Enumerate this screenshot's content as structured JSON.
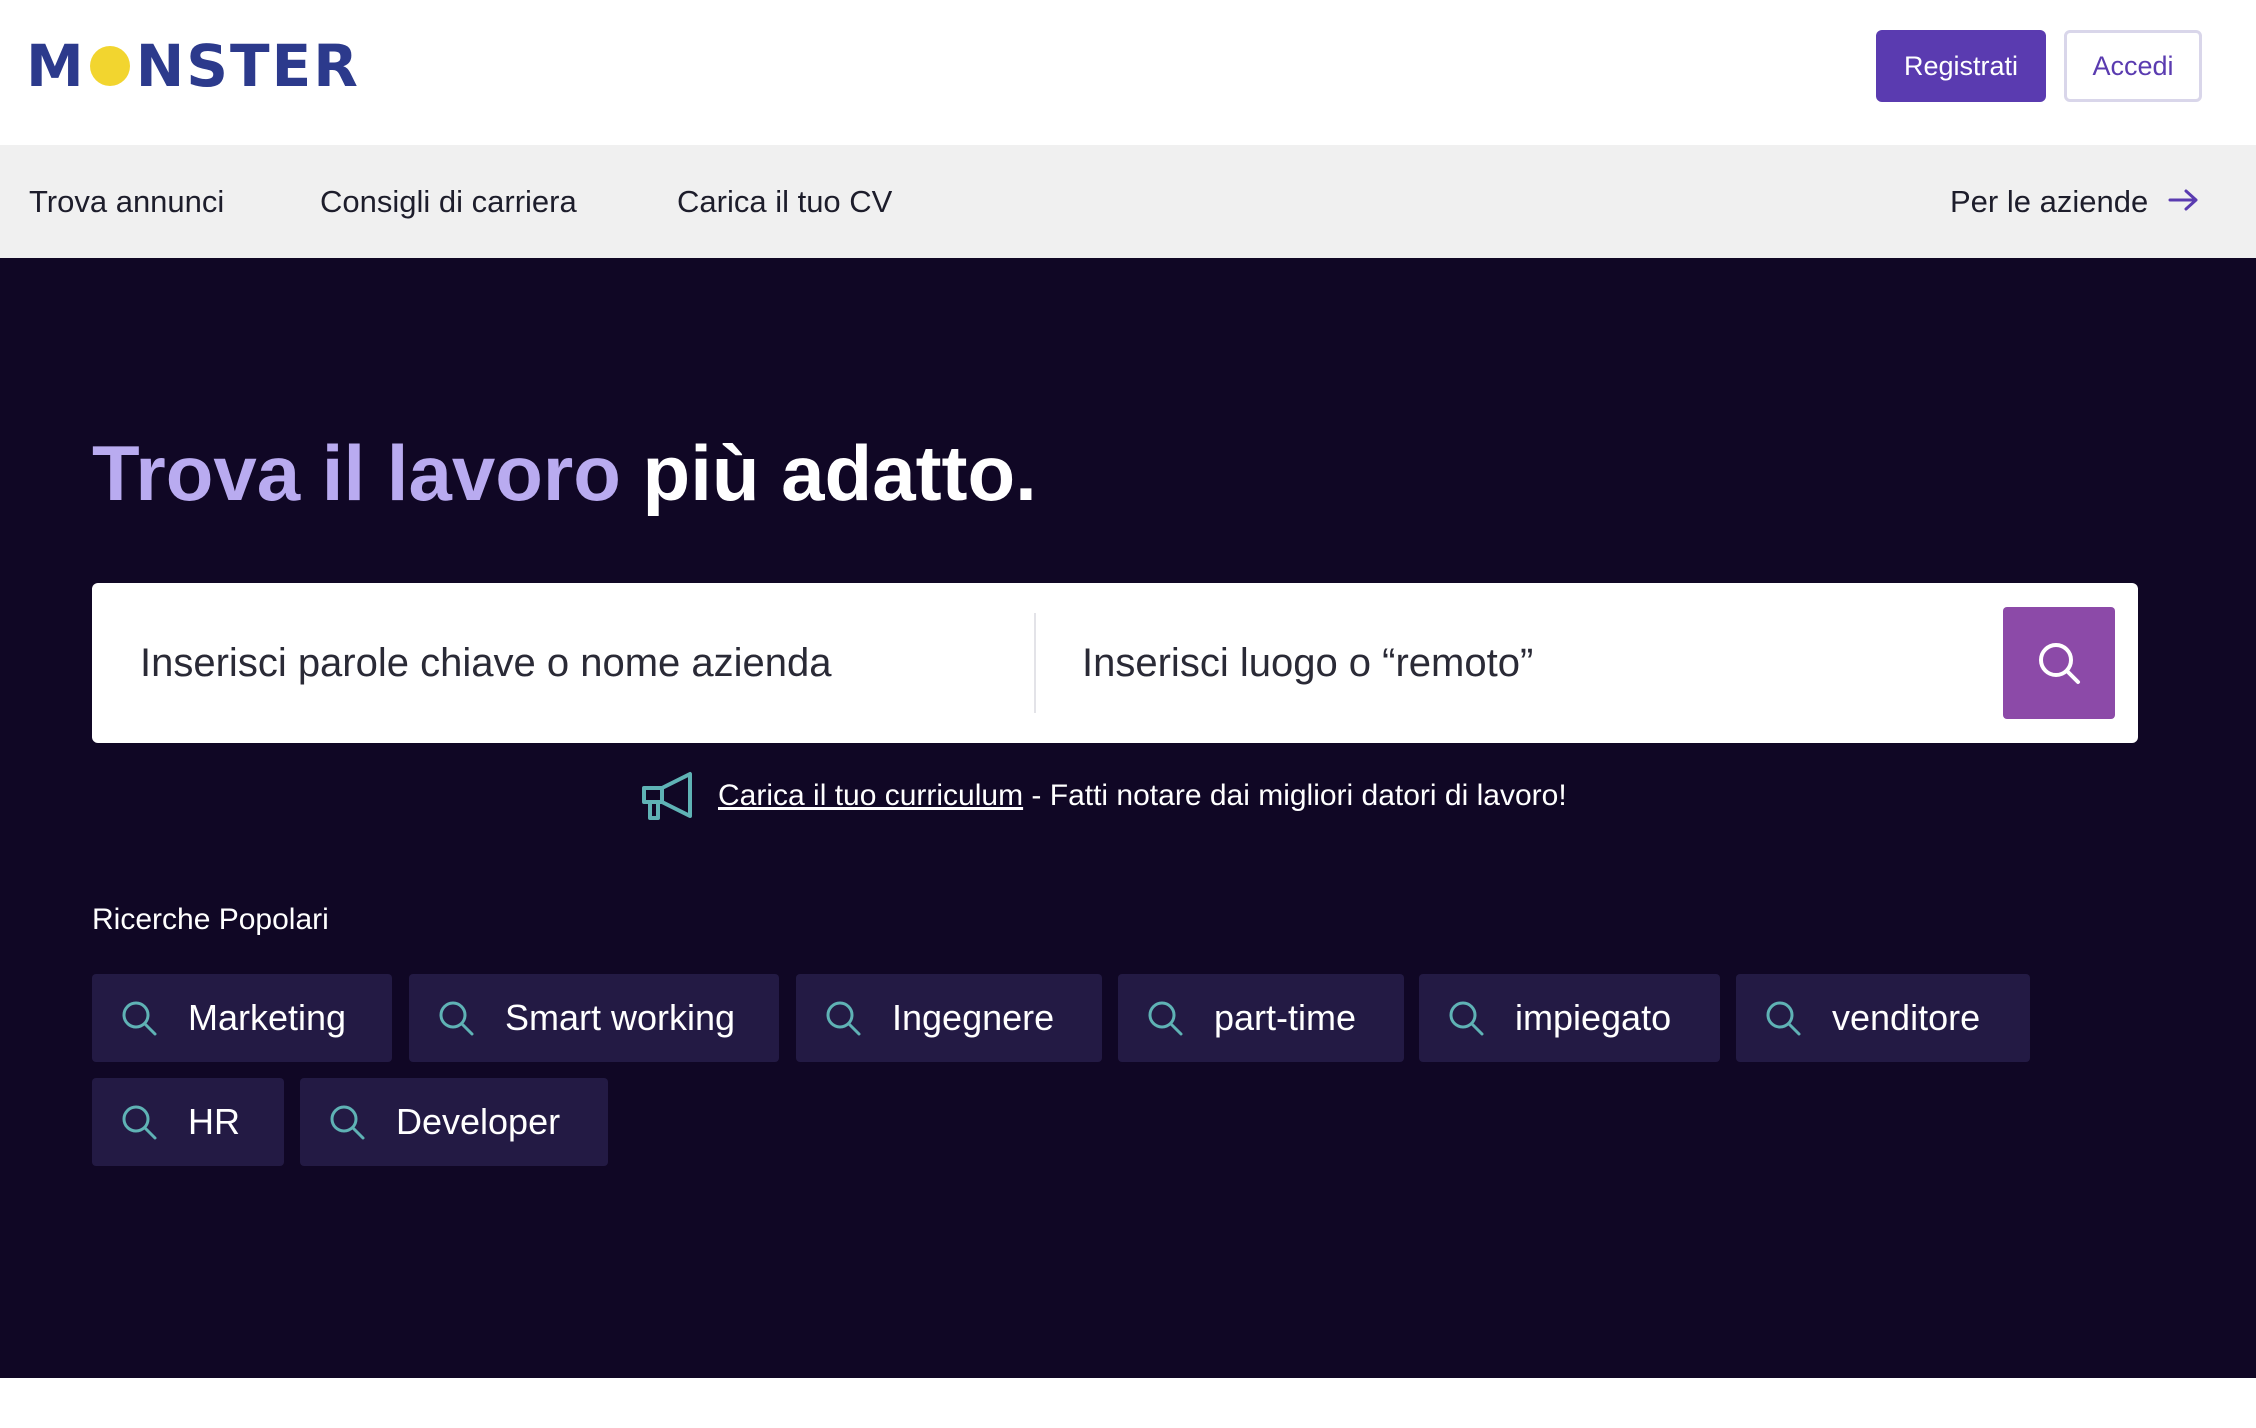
{
  "header": {
    "logo_text": "MONSTER",
    "logo_prefix": "M",
    "logo_suffix": "NSTER",
    "register_label": "Registrati",
    "login_label": "Accedi",
    "colors": {
      "brand": "#2c3a8c",
      "logo_dot": "#f2d52f",
      "accent": "#5a3bb0"
    }
  },
  "nav": {
    "items": [
      {
        "label": "Trova annunci"
      },
      {
        "label": "Consigli di carriera"
      },
      {
        "label": "Carica il tuo CV"
      }
    ],
    "business_label": "Per le aziende",
    "business_icon": "arrow-right-icon"
  },
  "hero": {
    "headline_part1": "Trova il lavoro",
    "headline_part2": "più adatto.",
    "search": {
      "keyword_placeholder": "Inserisci parole chiave o nome azienda",
      "location_placeholder": "Inserisci luogo o “remoto”",
      "button_icon": "search-icon",
      "button_color": "#8c4aa8"
    },
    "cv_promo": {
      "icon": "megaphone-icon",
      "link_text": "Carica il tuo curriculum",
      "text": " - Fatti notare dai migliori datori di lavoro!"
    },
    "popular": {
      "title": "Ricerche Popolari",
      "chips": [
        {
          "label": "Marketing"
        },
        {
          "label": "Smart working"
        },
        {
          "label": "Ingegnere"
        },
        {
          "label": "part-time"
        },
        {
          "label": "impiegato"
        },
        {
          "label": "venditore"
        },
        {
          "label": "HR"
        },
        {
          "label": "Developer"
        }
      ]
    },
    "colors": {
      "background": "#100725",
      "headline_accent": "#b9abf0",
      "chip_bg": "#231a44",
      "icon_teal": "#5fb2b5"
    }
  }
}
